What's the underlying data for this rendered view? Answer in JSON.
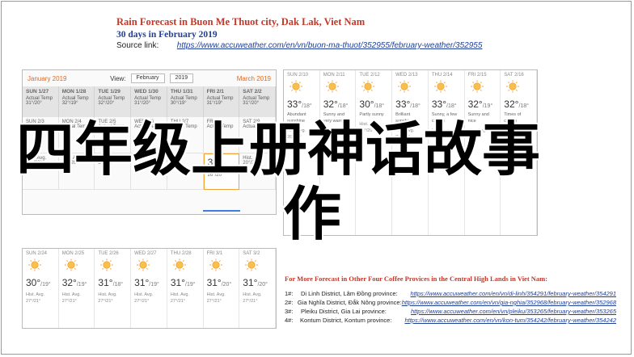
{
  "header": {
    "title": "Rain Forecast in Buon Me Thuot city, Dak Lak, Viet Nam",
    "subtitle": "30 days in February 2019",
    "source_label": "Source link:",
    "source_url": "https://www.accuweather.com/en/vn/buon-ma-thuot/352955/february-weather/352955"
  },
  "calendar": {
    "prev_month": "January 2019",
    "view_label": "View:",
    "month_select": "February",
    "year_select": "2019",
    "next_month": "March 2019",
    "head": [
      {
        "day": "SUN 1/27",
        "l1": "Actual Temp",
        "l2": "31°/20°"
      },
      {
        "day": "MON 1/28",
        "l1": "Actual Temp",
        "l2": "32°/19°"
      },
      {
        "day": "TUE 1/29",
        "l1": "Actual Temp",
        "l2": "32°/20°"
      },
      {
        "day": "WED 1/30",
        "l1": "Actual Temp",
        "l2": "31°/20°"
      },
      {
        "day": "THU 1/31",
        "l1": "Actual Temp",
        "l2": "30°/19°"
      },
      {
        "day": "FRI 2/1",
        "l1": "Actual Temp",
        "l2": "31°/19°"
      },
      {
        "day": "SAT 2/2",
        "l1": "Actual Temp",
        "l2": "31°/20°"
      }
    ],
    "rows": [
      [
        {
          "l1": "SUN 2/3",
          "l2": "Actual Temp"
        },
        {
          "l1": "MON 2/4",
          "l2": "Actual Temp"
        },
        {
          "l1": "TUE 2/5",
          "l2": "Actual Temp"
        },
        {
          "l1": "WED 2/6",
          "l2": "Actual Temp"
        },
        {
          "l1": "THU 2/7",
          "l2": "Actual Temp"
        },
        {
          "l1": "FRI 2/8",
          "l2": "Actual Temp"
        },
        {
          "l1": "SAT 2/9",
          "l2": "Actual Temp"
        }
      ],
      [
        {
          "l1": "Hist. Avg.",
          "l2": "20°/20°"
        },
        {
          "l1": "Hist. Avg.",
          "l2": "20°/20°"
        },
        {
          "l1": "Hist. Avg.",
          "l2": "20°/20°"
        },
        {
          "l1": "",
          "l2": ""
        },
        {
          "l1": "",
          "l2": ""
        },
        {
          "l1": "35°",
          "l2": "Hist. Avg. 26°/20°"
        },
        {
          "l1": "Hist. Avg.",
          "l2": "20°/20°"
        }
      ]
    ]
  },
  "forecast_b": [
    {
      "day": "SUN",
      "date": "2/10",
      "temp": "33°",
      "low": "/18°",
      "desc": "Abundant sunshine",
      "hist": "Hist. Avg. 26°/20°"
    },
    {
      "day": "MON",
      "date": "2/11",
      "temp": "32°",
      "low": "/18°",
      "desc": "Sunny and very warm",
      "hist": "Hist. Avg. 26°/20°"
    },
    {
      "day": "TUE",
      "date": "2/12",
      "temp": "30°",
      "low": "/18°",
      "desc": "Partly sunny",
      "hist": "Hist. Avg. 26°/20°"
    },
    {
      "day": "WED",
      "date": "2/13",
      "temp": "33°",
      "low": "/18°",
      "desc": "Brilliant sunshine",
      "hist": "Hist. Avg. 26°/20°"
    },
    {
      "day": "THU",
      "date": "2/14",
      "temp": "33°",
      "low": "/18°",
      "desc": "Sunny, a few clouds",
      "hist": "Hist. Avg. 26°/20°"
    },
    {
      "day": "FRI",
      "date": "2/15",
      "temp": "32°",
      "low": "/19°",
      "desc": "Sunny and nice",
      "hist": "Hist. Avg. 26°/20°"
    },
    {
      "day": "SAT",
      "date": "2/16",
      "temp": "32°",
      "low": "/18°",
      "desc": "Times of clouds",
      "hist": "Hist. Avg. 26°/20°"
    }
  ],
  "forecast_c": [
    {
      "day": "SUN",
      "date": "2/24",
      "temp": "30°",
      "low": "/19°",
      "hist": "Hist. Avg. 27°/21°"
    },
    {
      "day": "MON",
      "date": "2/25",
      "temp": "32°",
      "low": "/19°",
      "hist": "Hist. Avg. 27°/21°"
    },
    {
      "day": "TUE",
      "date": "2/26",
      "temp": "31°",
      "low": "/18°",
      "hist": "Hist. Avg. 27°/21°"
    },
    {
      "day": "WED",
      "date": "2/27",
      "temp": "31°",
      "low": "/19°",
      "hist": "Hist. Avg. 27°/21°"
    },
    {
      "day": "THU",
      "date": "2/28",
      "temp": "31°",
      "low": "/19°",
      "hist": "Hist. Avg. 27°/21°"
    },
    {
      "day": "FRI",
      "date": "3/1",
      "temp": "31°",
      "low": "/20°",
      "hist": "Hist. Avg. 27°/21°"
    },
    {
      "day": "SAT",
      "date": "3/2",
      "temp": "31°",
      "low": "/20°",
      "hist": "Hist. Avg. 27°/21°"
    }
  ],
  "more": {
    "title": "For More Forecast in Other Four Coffee Provices in the Central High Lands in Viet Nam:",
    "items": [
      {
        "num": "1#:",
        "district": "Di Linh District, Lâm Đồng province:",
        "url": "https://www.accuweather.com/en/vn/di-linh/354291/february-weather/354291"
      },
      {
        "num": "2#:",
        "district": "Gia Nghĩa District, Đắk Nông province:",
        "url": "https://www.accuweather.com/en/vn/gia-nghia/352968/february-weather/352968"
      },
      {
        "num": "3#:",
        "district": "Pleiku District, Gia Lai province:",
        "url": "https://www.accuweather.com/en/vn/pleiku/353265/february-weather/353265"
      },
      {
        "num": "4#:",
        "district": "Kontum District, Kontum province:",
        "url": "https://www.accuweather.com/en/vn/kon-tum/354242/february-weather/354242"
      }
    ]
  },
  "overlay": {
    "line1": "四年级上册神话故事",
    "line2": "作"
  },
  "colors": {
    "title_red": "#c0392b",
    "link_blue": "#1f3f99",
    "sun_orange": "#f2a33a"
  }
}
